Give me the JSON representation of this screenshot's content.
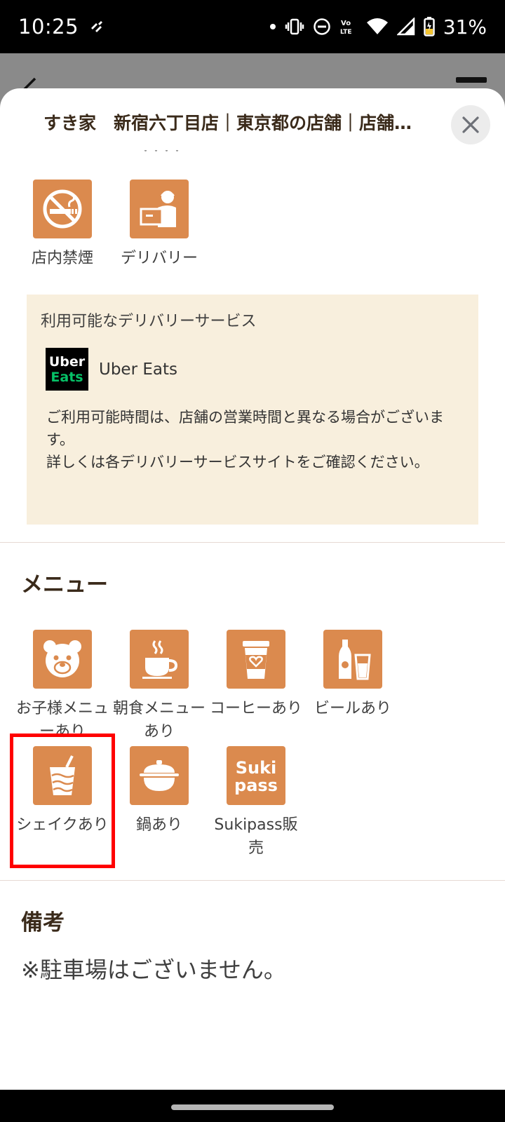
{
  "status_bar": {
    "time": "10:25",
    "battery_percent": "31%",
    "icons": [
      "notification-app-icon",
      "dot-icon",
      "vibrate-icon",
      "dnd-icon",
      "volte-icon",
      "wifi-icon",
      "signal-icon",
      "battery-icon"
    ]
  },
  "sheet": {
    "title": "すき家　新宿六丁目店｜東京都の店舗｜店舗検索｜すき家",
    "close_icon": "close-icon"
  },
  "facilities": {
    "items": [
      {
        "label": "店内禁煙",
        "icon": "no-smoking-icon"
      },
      {
        "label": "デリバリー",
        "icon": "delivery-icon"
      }
    ]
  },
  "delivery": {
    "heading": "利用可能なデリバリーサービス",
    "service_logo_top": "Uber",
    "service_logo_bottom": "Eats",
    "service_name": "Uber Eats",
    "note_line1": "ご利用可能時間は、店舗の営業時間と異なる場合がございます。",
    "note_line2": "詳しくは各デリバリーサービスサイトをご確認ください。"
  },
  "menu": {
    "heading": "メニュー",
    "items": [
      {
        "label": "お子様メニューあり",
        "icon": "bear-icon"
      },
      {
        "label": "朝食メニューあり",
        "icon": "coffee-cup-icon"
      },
      {
        "label": "コーヒーあり",
        "icon": "takeout-coffee-icon"
      },
      {
        "label": "ビールあり",
        "icon": "beer-icon"
      },
      {
        "label": "シェイクあり",
        "icon": "shake-icon"
      },
      {
        "label": "鍋あり",
        "icon": "pot-icon"
      },
      {
        "label": "Sukipass販売",
        "icon": "sukipass-icon",
        "logo_top": "Suki",
        "logo_bottom": "pass"
      }
    ]
  },
  "remarks": {
    "heading": "備考",
    "text": "※駐車場はございません。"
  },
  "colors": {
    "accent": "#db8a4e",
    "info_box": "#f8efdd",
    "highlight": "#ff0000",
    "heading_text": "#3a2a1a"
  }
}
